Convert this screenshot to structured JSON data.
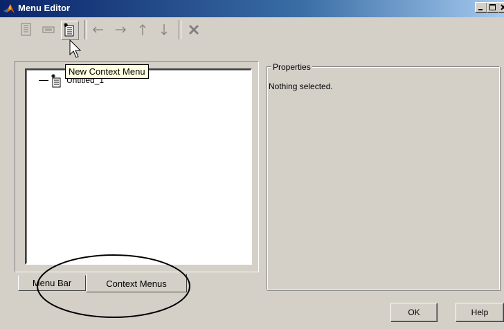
{
  "window": {
    "title": "Menu Editor",
    "controls": [
      "minimize",
      "maximize",
      "close"
    ]
  },
  "toolbar": {
    "buttons": [
      {
        "name": "new-menu",
        "icon": "new-menu-icon"
      },
      {
        "name": "new-menu-item",
        "icon": "new-menu-item-icon"
      },
      {
        "name": "new-context-menu",
        "icon": "new-context-menu-icon"
      },
      {
        "name": "move-left",
        "icon": "arrow-left-icon"
      },
      {
        "name": "move-right",
        "icon": "arrow-right-icon"
      },
      {
        "name": "move-up",
        "icon": "arrow-up-icon"
      },
      {
        "name": "move-down",
        "icon": "arrow-down-icon"
      },
      {
        "name": "delete",
        "icon": "delete-icon"
      }
    ],
    "tooltip": "New Context Menu"
  },
  "tree": {
    "items": [
      {
        "label": "Untitled_1",
        "icon": "context-menu-icon"
      }
    ]
  },
  "tabs": [
    {
      "label": "Menu Bar",
      "active": false
    },
    {
      "label": "Context Menus",
      "active": true
    }
  ],
  "properties": {
    "legend": "Properties",
    "status": "Nothing selected."
  },
  "buttons": {
    "ok": "OK",
    "help": "Help"
  },
  "colors": {
    "titlebar_start": "#0a246a",
    "titlebar_end": "#a6caf0",
    "face": "#d4d0c8",
    "tooltip_bg": "#ffffe1"
  }
}
